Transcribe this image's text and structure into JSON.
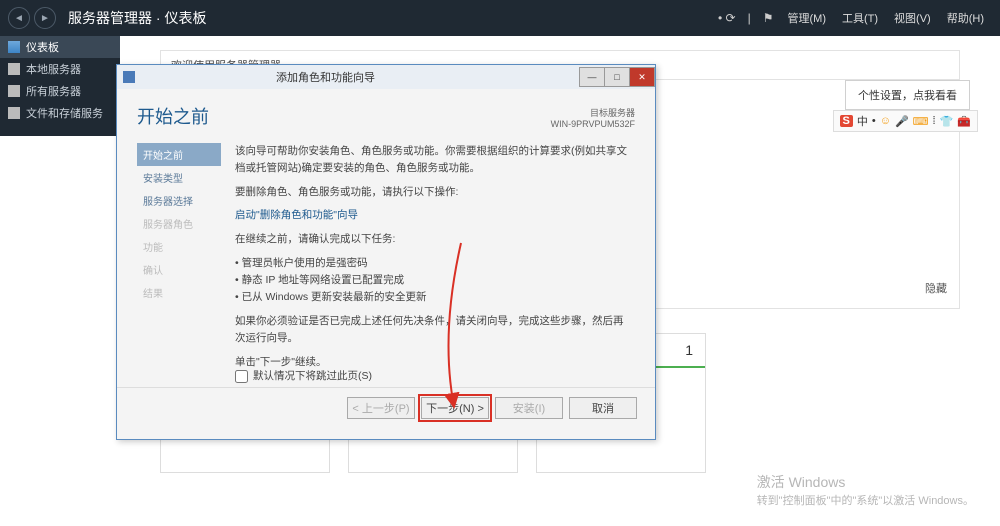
{
  "titlebar": {
    "title": "服务器管理器 · 仪表板",
    "menu": {
      "manage": "管理(M)",
      "tools": "工具(T)",
      "view": "视图(V)",
      "help": "帮助(H)"
    }
  },
  "sidebar": {
    "items": [
      {
        "label": "仪表板"
      },
      {
        "label": "本地服务器"
      },
      {
        "label": "所有服务器"
      },
      {
        "label": "文件和存储服务"
      }
    ]
  },
  "main": {
    "welcome": "欢迎使用服务器管理器",
    "hide": "隐藏",
    "tile_number": "1"
  },
  "notif": {
    "text": "个性设置，点我看看"
  },
  "sogou": {
    "badge": "S",
    "ch": "中"
  },
  "wizard": {
    "title": "添加角色和功能向导",
    "target_label": "目标服务器",
    "target_server": "WIN-9PRVPUM532F",
    "heading": "开始之前",
    "nav": [
      "开始之前",
      "安装类型",
      "服务器选择",
      "服务器角色",
      "功能",
      "确认",
      "结果"
    ],
    "p1": "该向导可帮助你安装角色、角色服务或功能。你需要根据组织的计算要求(例如共享文档或托管网站)确定要安装的角色、角色服务或功能。",
    "p2": "要删除角色、角色服务或功能，请执行以下操作:",
    "link": "启动\"删除角色和功能\"向导",
    "p3": "在继续之前，请确认完成以下任务:",
    "bullets": [
      "管理员帐户使用的是强密码",
      "静态 IP 地址等网络设置已配置完成",
      "已从 Windows 更新安装最新的安全更新"
    ],
    "p4": "如果你必须验证是否已完成上述任何先决条件，请关闭向导，完成这些步骤，然后再次运行向导。",
    "p5": "单击\"下一步\"继续。",
    "skip": "默认情况下将跳过此页(S)",
    "buttons": {
      "prev": "< 上一步(P)",
      "next": "下一步(N) >",
      "install": "安装(I)",
      "cancel": "取消"
    }
  },
  "activate": {
    "line1": "激活 Windows",
    "line2": "转到\"控制面板\"中的\"系统\"以激活 Windows。"
  }
}
